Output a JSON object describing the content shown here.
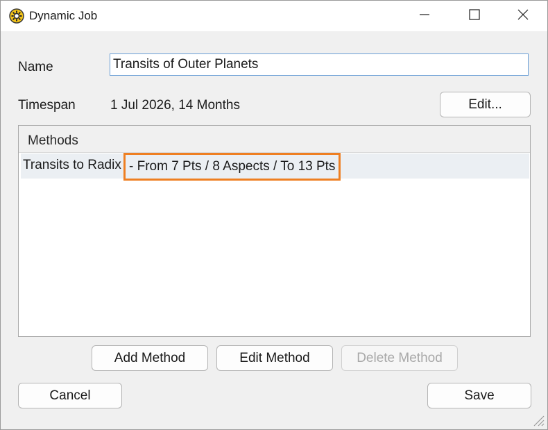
{
  "window": {
    "title": "Dynamic Job",
    "icon": "sun-gear-icon",
    "controls": {
      "minimize": "minimize-icon",
      "maximize": "maximize-icon",
      "close": "close-icon"
    }
  },
  "form": {
    "name_label": "Name",
    "name_value": "Transits of Outer Planets",
    "timespan_label": "Timespan",
    "timespan_value": "1 Jul 2026, 14 Months",
    "edit_button": "Edit..."
  },
  "methods": {
    "header": "Methods",
    "items": [
      {
        "name": "Transits to Radix",
        "detail": "- From 7 Pts / 8 Aspects / To 13 Pts",
        "selected": true
      }
    ]
  },
  "actions": {
    "add_method": "Add Method",
    "edit_method": "Edit Method",
    "delete_method": "Delete Method",
    "cancel": "Cancel",
    "save": "Save"
  },
  "colors": {
    "highlight_border": "#ee7f22",
    "input_focus_border": "#6a9fd6",
    "selected_row": "#ebeff3"
  }
}
